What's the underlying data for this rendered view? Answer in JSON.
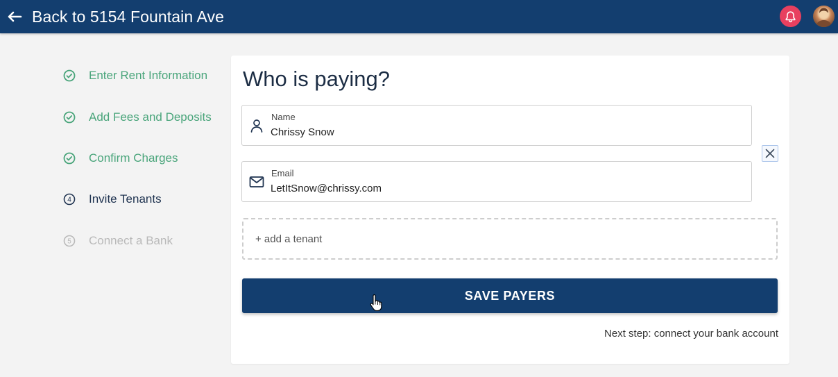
{
  "header": {
    "back_title": "Back to 5154 Fountain Ave",
    "back_icon": "arrow-left-icon",
    "notification_icon": "bell-icon",
    "avatar_icon": "user-avatar",
    "bar_color": "#133e6f",
    "bell_color": "#e8405f"
  },
  "steps": [
    {
      "label": "Enter Rent Information",
      "status": "done",
      "icon": "check-circle-icon"
    },
    {
      "label": "Add Fees and Deposits",
      "status": "done",
      "icon": "check-circle-icon"
    },
    {
      "label": "Confirm Charges",
      "status": "done",
      "icon": "check-circle-icon"
    },
    {
      "label": "Invite Tenants",
      "status": "current",
      "number": "4"
    },
    {
      "label": "Connect a Bank",
      "status": "pending",
      "number": "5"
    }
  ],
  "form": {
    "heading": "Who is paying?",
    "name_label": "Name",
    "name_value": "Chrissy Snow",
    "name_icon": "person-icon",
    "email_label": "Email",
    "email_value": "LetItSnow@chrissy.com",
    "email_icon": "envelope-icon",
    "remove_icon": "close-icon",
    "add_tenant_label": "+ add a tenant",
    "save_button_label": "SAVE PAYERS",
    "next_step_text": "Next step: connect your bank account"
  },
  "colors": {
    "done": "#4aa57b",
    "current": "#1f3350",
    "pending": "#b9b9b9"
  }
}
